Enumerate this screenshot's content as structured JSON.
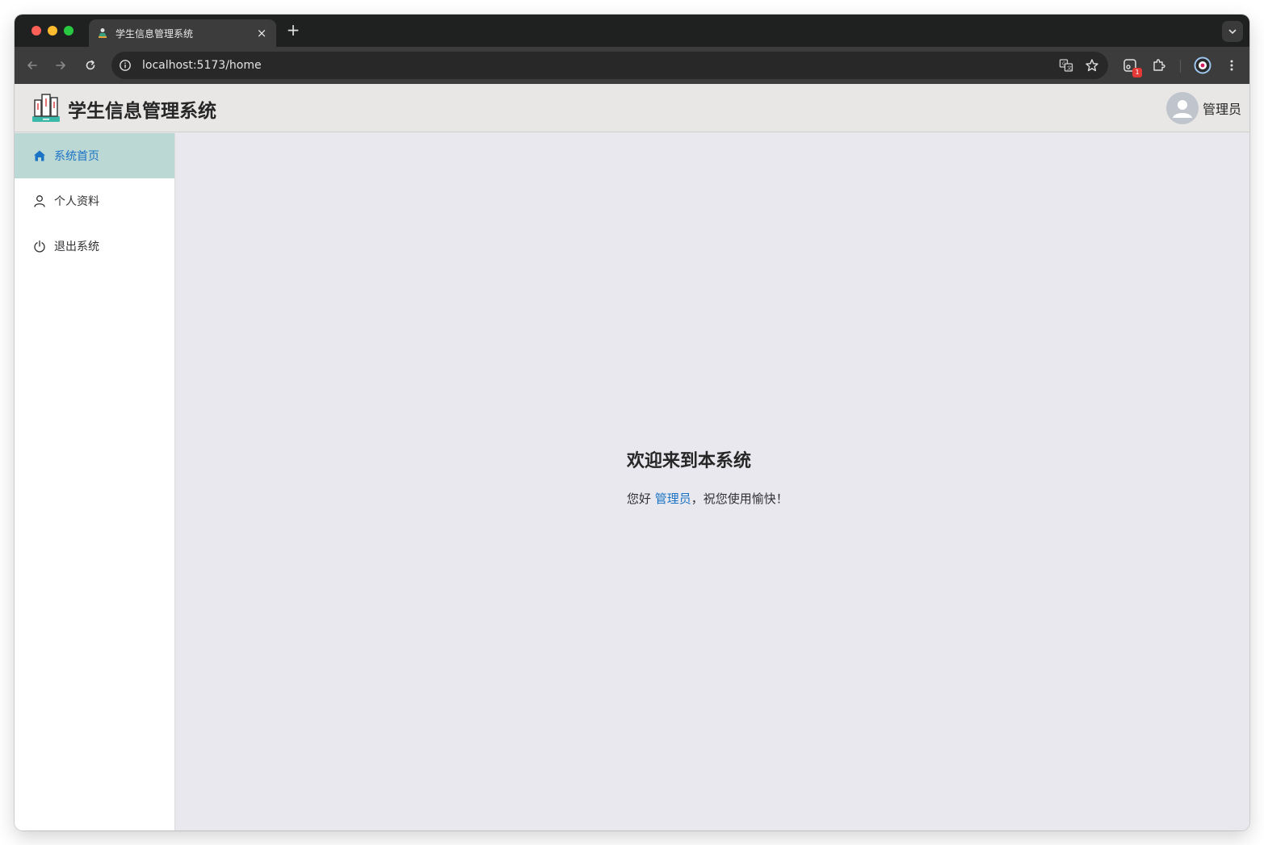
{
  "browser": {
    "tab_title": "学生信息管理系统",
    "tab_close": "×",
    "new_tab": "+",
    "url": "localhost:5173/home",
    "extension_badge": "1"
  },
  "app": {
    "title": "学生信息管理系统",
    "user_name": "管理员"
  },
  "sidebar": {
    "items": [
      {
        "label": "系统首页",
        "icon": "home-icon",
        "active": true
      },
      {
        "label": "个人资料",
        "icon": "user-icon",
        "active": false
      },
      {
        "label": "退出系统",
        "icon": "power-icon",
        "active": false
      }
    ]
  },
  "welcome": {
    "title": "欢迎来到本系统",
    "greeting_prefix": "您好 ",
    "user": "管理员",
    "greeting_suffix": "，祝您使用愉快！"
  },
  "colors": {
    "accent": "#1a73c5",
    "active_menu_bg": "#bcd8d4",
    "main_bg": "#e9e8ee",
    "header_bg": "#e8e7e6"
  }
}
